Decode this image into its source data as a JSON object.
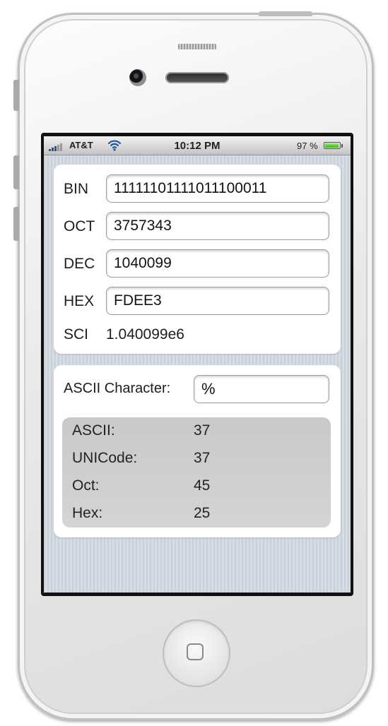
{
  "status_bar": {
    "carrier": "AT&T",
    "time": "10:12 PM",
    "battery_percent": "97 %",
    "battery_level": 0.97,
    "signal_icon": "signal-bars-icon",
    "wifi_icon": "wifi-icon"
  },
  "converter": {
    "rows": [
      {
        "label": "BIN",
        "value": "11111101111011100011"
      },
      {
        "label": "OCT",
        "value": "3757343"
      },
      {
        "label": "DEC",
        "value": "1040099"
      },
      {
        "label": "HEX",
        "value": "FDEE3"
      }
    ],
    "sci": {
      "label": "SCI",
      "value": "1.040099e6"
    }
  },
  "ascii": {
    "label": "ASCII Character:",
    "value": "%",
    "info": [
      {
        "key": "ASCII:",
        "value": "37"
      },
      {
        "key": "UNICode:",
        "value": "37"
      },
      {
        "key": "Oct:",
        "value": "45"
      },
      {
        "key": "Hex:",
        "value": "25"
      }
    ]
  },
  "colors": {
    "battery": "#33b413",
    "signal": "#1f56a3",
    "info_box": "#cccccc"
  }
}
